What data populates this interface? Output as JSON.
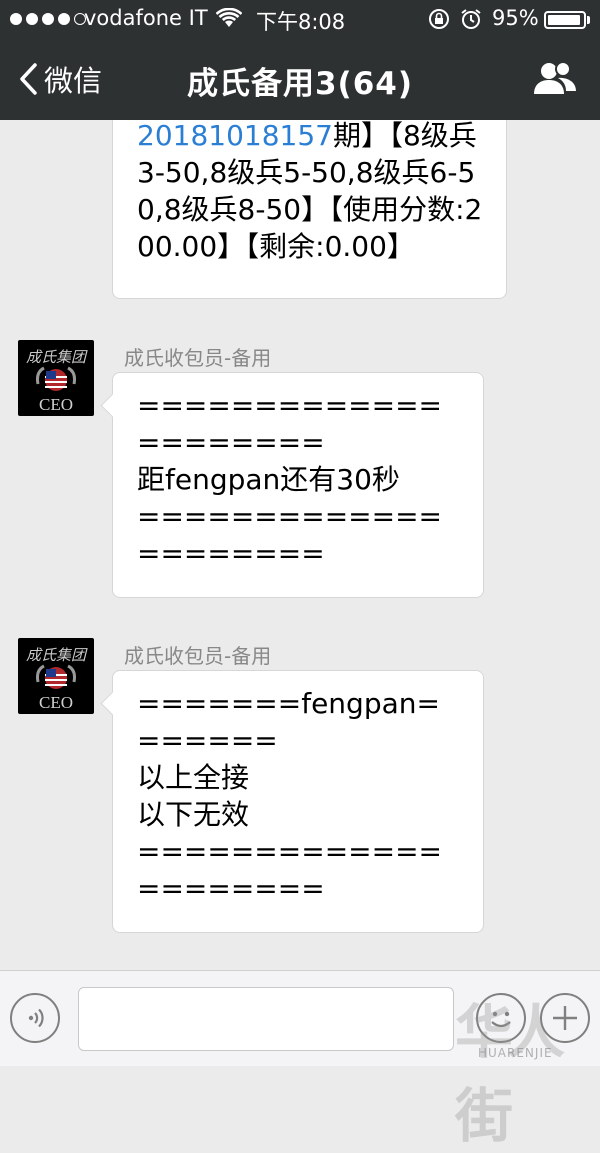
{
  "status_bar": {
    "carrier": "vodafone IT",
    "time": "下午8:08",
    "battery_percent": "95%",
    "battery_level": 0.95,
    "signal_strength": 4,
    "signal_max": 5
  },
  "nav": {
    "back_label": "微信",
    "title": "成氏备用3(64)"
  },
  "messages": [
    {
      "sender": "",
      "link_text": "20181018157",
      "text": "期】【8级兵3-50,8级兵5-50,8级兵6-50,8级兵8-50】【使用分数:200.00】【剩余:0.00】"
    },
    {
      "sender": "成氏收包员-备用",
      "avatar_text": "成氏集团",
      "avatar_sub": "CEO",
      "text": "=====================\n距fengpan还有30秒\n====================="
    },
    {
      "sender": "成氏收包员-备用",
      "avatar_text": "成氏集团",
      "avatar_sub": "CEO",
      "text": "=======fengpan=======\n以上全接\n以下无效\n====================="
    }
  ],
  "input": {
    "placeholder": ""
  },
  "watermark": {
    "text": "华人街",
    "sub": "HUARENJIE"
  },
  "colors": {
    "nav_bg": "#2e3132",
    "chat_bg": "#ebebeb",
    "link": "#2a7fd4"
  }
}
